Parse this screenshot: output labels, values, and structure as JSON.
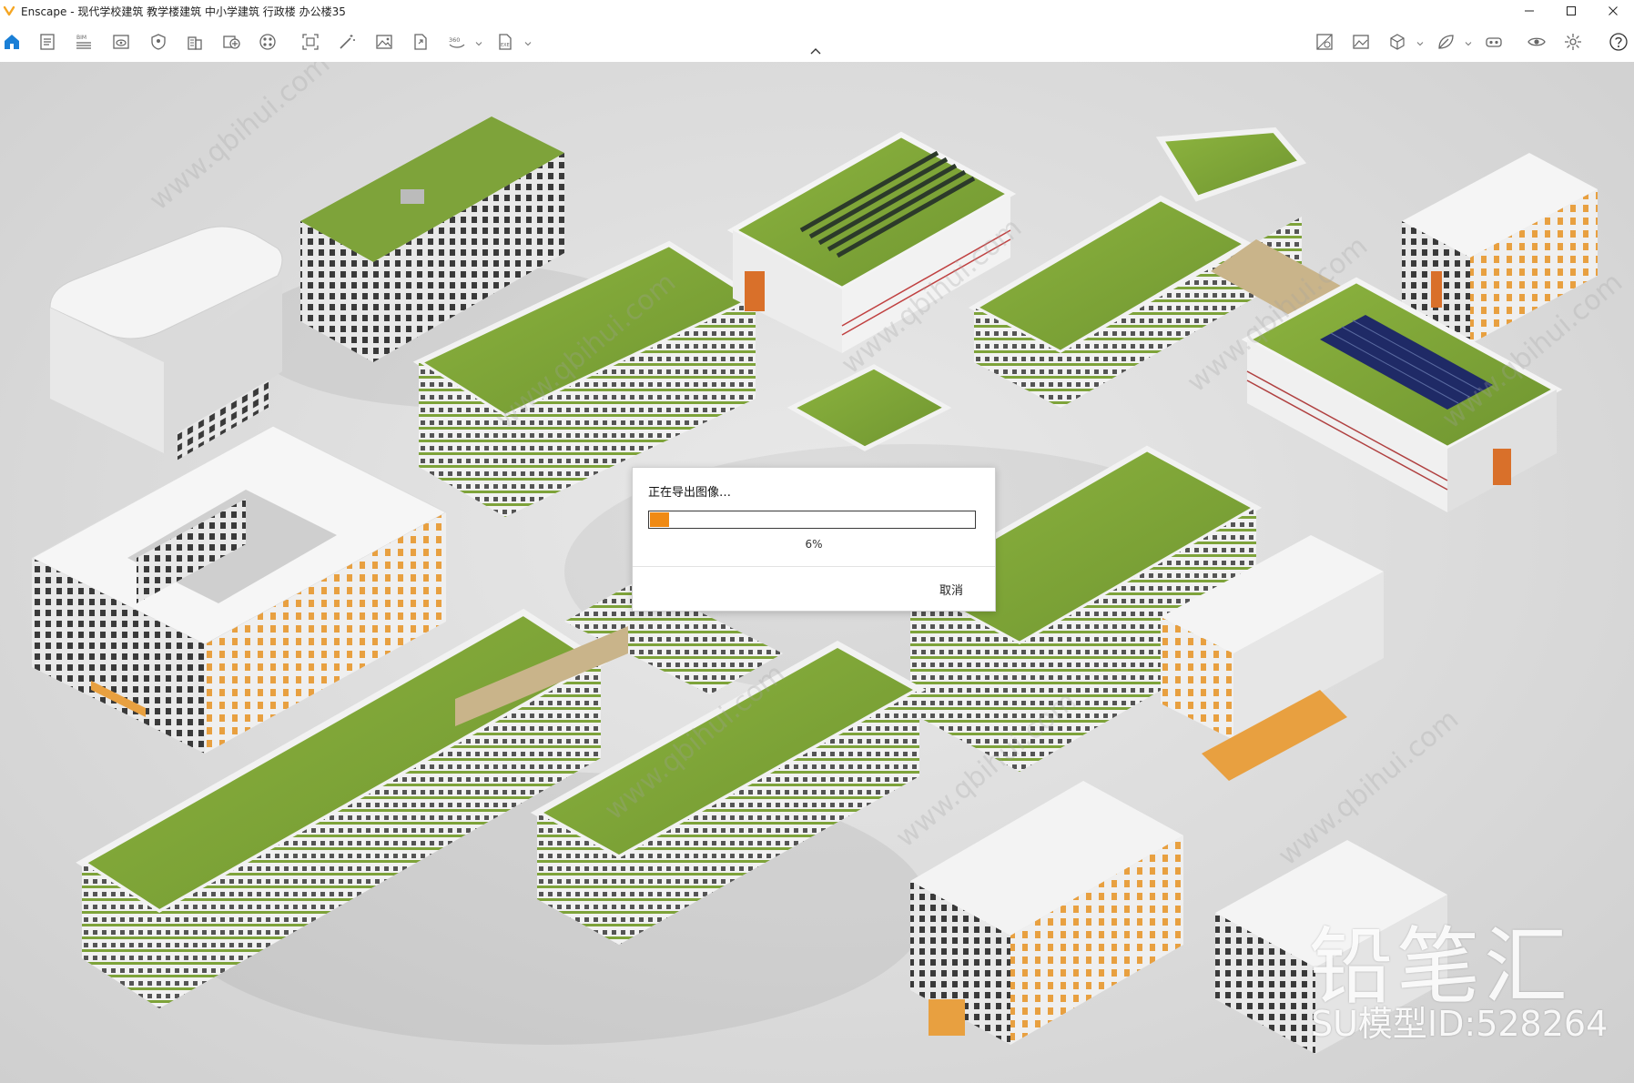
{
  "window": {
    "title": "Enscape - 现代学校建筑 教学楼建筑 中小学建筑 行政楼 办公楼35",
    "controls": [
      "minimize-icon",
      "maximize-icon",
      "close-icon"
    ]
  },
  "toolbar": {
    "left_icons": [
      "home-icon",
      "notes-icon",
      "bim-icon",
      "view-icon",
      "shield-icon",
      "building-icon",
      "asset-library-icon",
      "materials-icon",
      "capture-icon",
      "magic-wand-icon",
      "image-export-icon",
      "file-export-icon",
      "panorama-360-icon",
      "exe-export-icon"
    ],
    "right_icons": [
      "visual-settings-icon",
      "image-settings-icon",
      "cube-icon",
      "leaf-icon",
      "vr-headset-icon",
      "eye-icon",
      "settings-icon",
      "help-icon"
    ]
  },
  "dialog": {
    "title": "正在导出图像…",
    "progress_percent": 6,
    "progress_label": "6%",
    "cancel_label": "取消"
  },
  "colors": {
    "accent_orange": "#f08a14",
    "roof_green": "#7ea33a",
    "facade_white": "#f2f2f2",
    "solar_blue": "#1f2a66"
  },
  "watermark": {
    "brand": "铅笔汇",
    "model_id": "SU模型ID:528264",
    "tiled_text": "www.qbihui.com"
  }
}
